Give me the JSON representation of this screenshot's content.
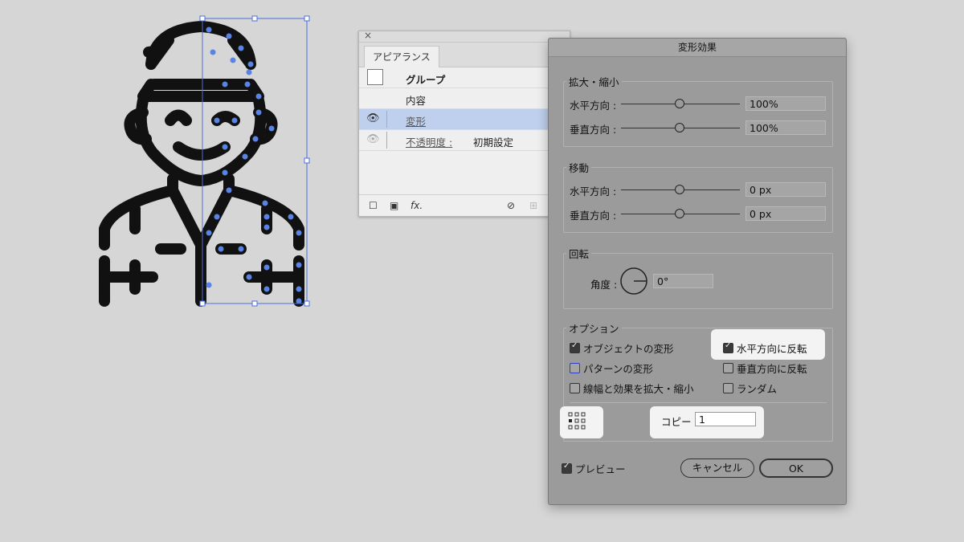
{
  "appearance_panel": {
    "tab": "アピアランス",
    "rows": [
      {
        "label": "グループ"
      },
      {
        "label": "内容"
      },
      {
        "label": "変形"
      },
      {
        "label": "不透明度 :",
        "value": "初期設定"
      }
    ],
    "footer_icons": [
      "new-stroke-icon",
      "new-fill-icon",
      "fx-icon",
      "clear-icon",
      "duplicate-icon"
    ],
    "fx_label": "fx."
  },
  "dialog": {
    "title": "変形効果",
    "scale": {
      "label": "拡大・縮小",
      "horizontal_label": "水平方向 :",
      "horizontal_value": "100%",
      "vertical_label": "垂直方向 :",
      "vertical_value": "100%"
    },
    "move": {
      "label": "移動",
      "horizontal_label": "水平方向 :",
      "horizontal_value": "0 px",
      "vertical_label": "垂直方向 :",
      "vertical_value": "0 px"
    },
    "rotate": {
      "label": "回転",
      "angle_label": "角度 :",
      "angle_value": "0°"
    },
    "options": {
      "label": "オプション",
      "transform_objects": "オブジェクトの変形",
      "transform_patterns": "パターンの変形",
      "scale_strokes": "線幅と効果を拡大・縮小",
      "reflect_x": "水平方向に反転",
      "reflect_y": "垂直方向に反転",
      "random": "ランダム"
    },
    "copies_label": "コピー",
    "copies_value": "1",
    "preview_label": "プレビュー",
    "cancel_label": "キャンセル",
    "ok_label": "OK"
  }
}
